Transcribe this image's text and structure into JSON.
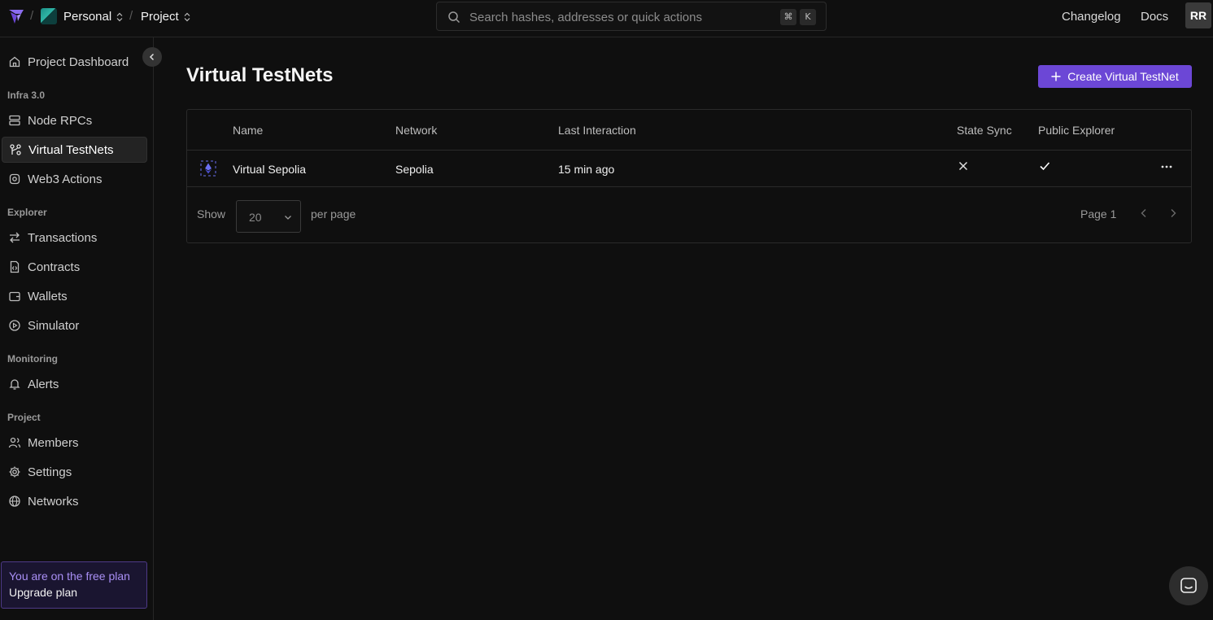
{
  "topbar": {
    "workspace": "Personal",
    "project": "Project",
    "separator": "/",
    "search_placeholder": "Search hashes, addresses or quick actions",
    "shortcut_cmd": "⌘",
    "shortcut_key": "K",
    "changelog": "Changelog",
    "docs": "Docs",
    "user_initials": "RR"
  },
  "sidebar": {
    "dashboard": "Project Dashboard",
    "sections": {
      "infra": "Infra 3.0",
      "explorer": "Explorer",
      "monitoring": "Monitoring",
      "project": "Project"
    },
    "items": {
      "node_rpcs": "Node RPCs",
      "virtual_testnets": "Virtual TestNets",
      "web3_actions": "Web3 Actions",
      "transactions": "Transactions",
      "contracts": "Contracts",
      "wallets": "Wallets",
      "simulator": "Simulator",
      "alerts": "Alerts",
      "members": "Members",
      "settings": "Settings",
      "networks": "Networks"
    },
    "active_item": "virtual_testnets",
    "plan_text": "You are on the free plan",
    "upgrade": "Upgrade plan"
  },
  "main": {
    "title": "Virtual TestNets",
    "create_button": "Create Virtual TestNet",
    "columns": {
      "name": "Name",
      "network": "Network",
      "last_interaction": "Last Interaction",
      "state_sync": "State Sync",
      "public_explorer": "Public Explorer"
    },
    "rows": [
      {
        "name": "Virtual Sepolia",
        "network": "Sepolia",
        "last_interaction": "15 min ago",
        "state_sync": false,
        "public_explorer": true
      }
    ],
    "pagination": {
      "show": "Show",
      "page_size": "20",
      "per_page": "per page",
      "page_info": "Page 1"
    }
  },
  "colors": {
    "accent": "#6c47d6",
    "background": "#0f0f0f",
    "plan_text": "#a98ff5"
  }
}
